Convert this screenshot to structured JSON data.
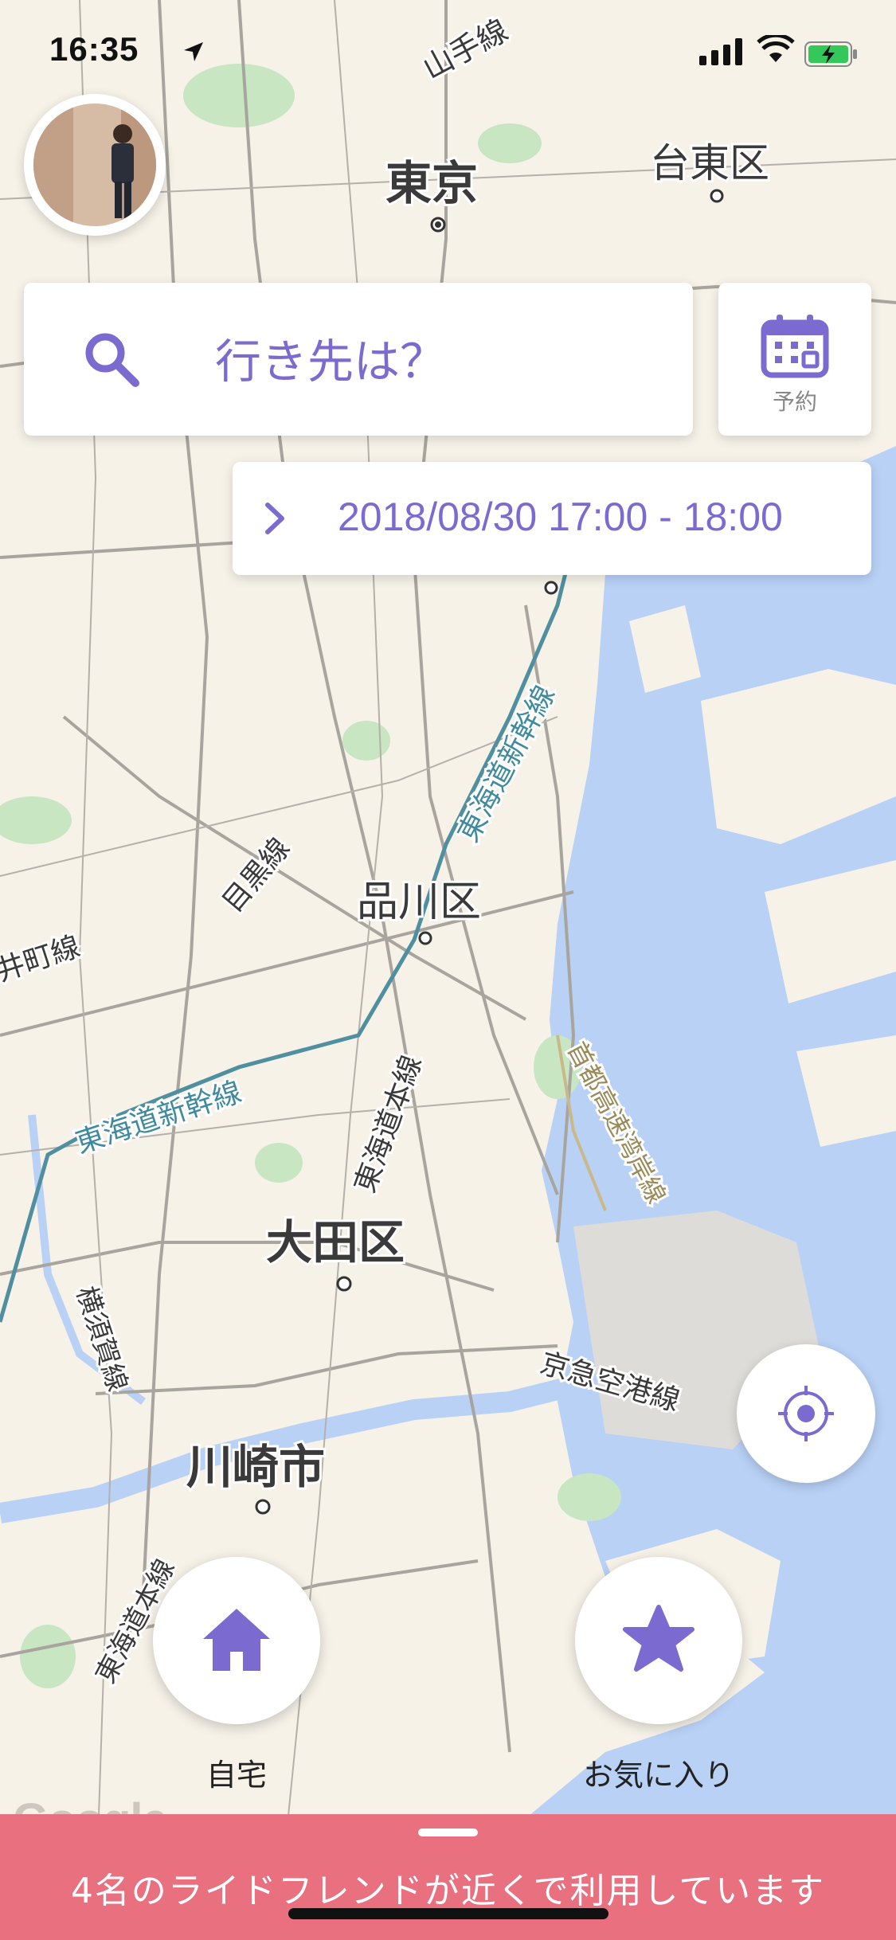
{
  "status_bar": {
    "time": "16:35"
  },
  "search": {
    "placeholder": "行き先は？",
    "reserve_label": "予約"
  },
  "schedule": {
    "datetime": "2018/08/30 17:00 - 18:00"
  },
  "shortcuts": {
    "home_label": "自宅",
    "favorites_label": "お気に入り"
  },
  "banner": {
    "text": "4名のライドフレンドが近くで利用しています"
  },
  "map": {
    "attribution": "Google",
    "labels": {
      "tokyo": "東京",
      "taito": "台東区",
      "yamanote": "山手線",
      "shinagawa": "品川区",
      "meguro_line": "目黒線",
      "oimachi": "井町線",
      "tokaido_shinkansen_1": "東海道新幹線",
      "tokaido_shinkansen_2": "東海道新幹線",
      "tokaido_honsen_1": "東海道本線",
      "tokaido_honsen_2": "東海道本線",
      "shuto_wangan": "首都高速湾岸線",
      "ota": "大田区",
      "yokosuka": "横須賀線",
      "keikyu": "京急空港線",
      "kawasaki": "川崎市"
    }
  },
  "colors": {
    "accent": "#7b6bd0",
    "banner": "#e8707f",
    "water": "#b8d1f5",
    "land": "#f6f2e8",
    "park": "#c8e6c2"
  }
}
